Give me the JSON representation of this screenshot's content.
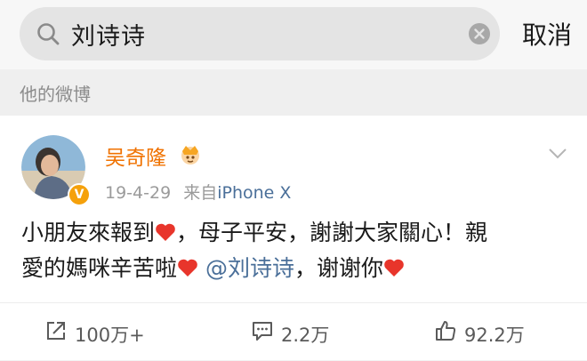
{
  "search": {
    "query": "刘诗诗",
    "cancel_label": "取消"
  },
  "section": {
    "title": "他的微博"
  },
  "post": {
    "author": "吴奇隆",
    "date": "19-4-29",
    "source_prefix": "来自",
    "source": "iPhone X",
    "text_part1": "小朋友來報到",
    "text_part2": "，母子平安，謝謝大家關心！親",
    "text_part3": "愛的媽咪辛苦啦",
    "mention": "@刘诗诗",
    "text_part4": "，谢谢你",
    "verified_badge": "V"
  },
  "actions": {
    "repost": "100万+",
    "comment": "2.2万",
    "like": "92.2万"
  },
  "colors": {
    "username": "#f07200",
    "link": "#4a6f99",
    "heart": "#e8352b"
  }
}
